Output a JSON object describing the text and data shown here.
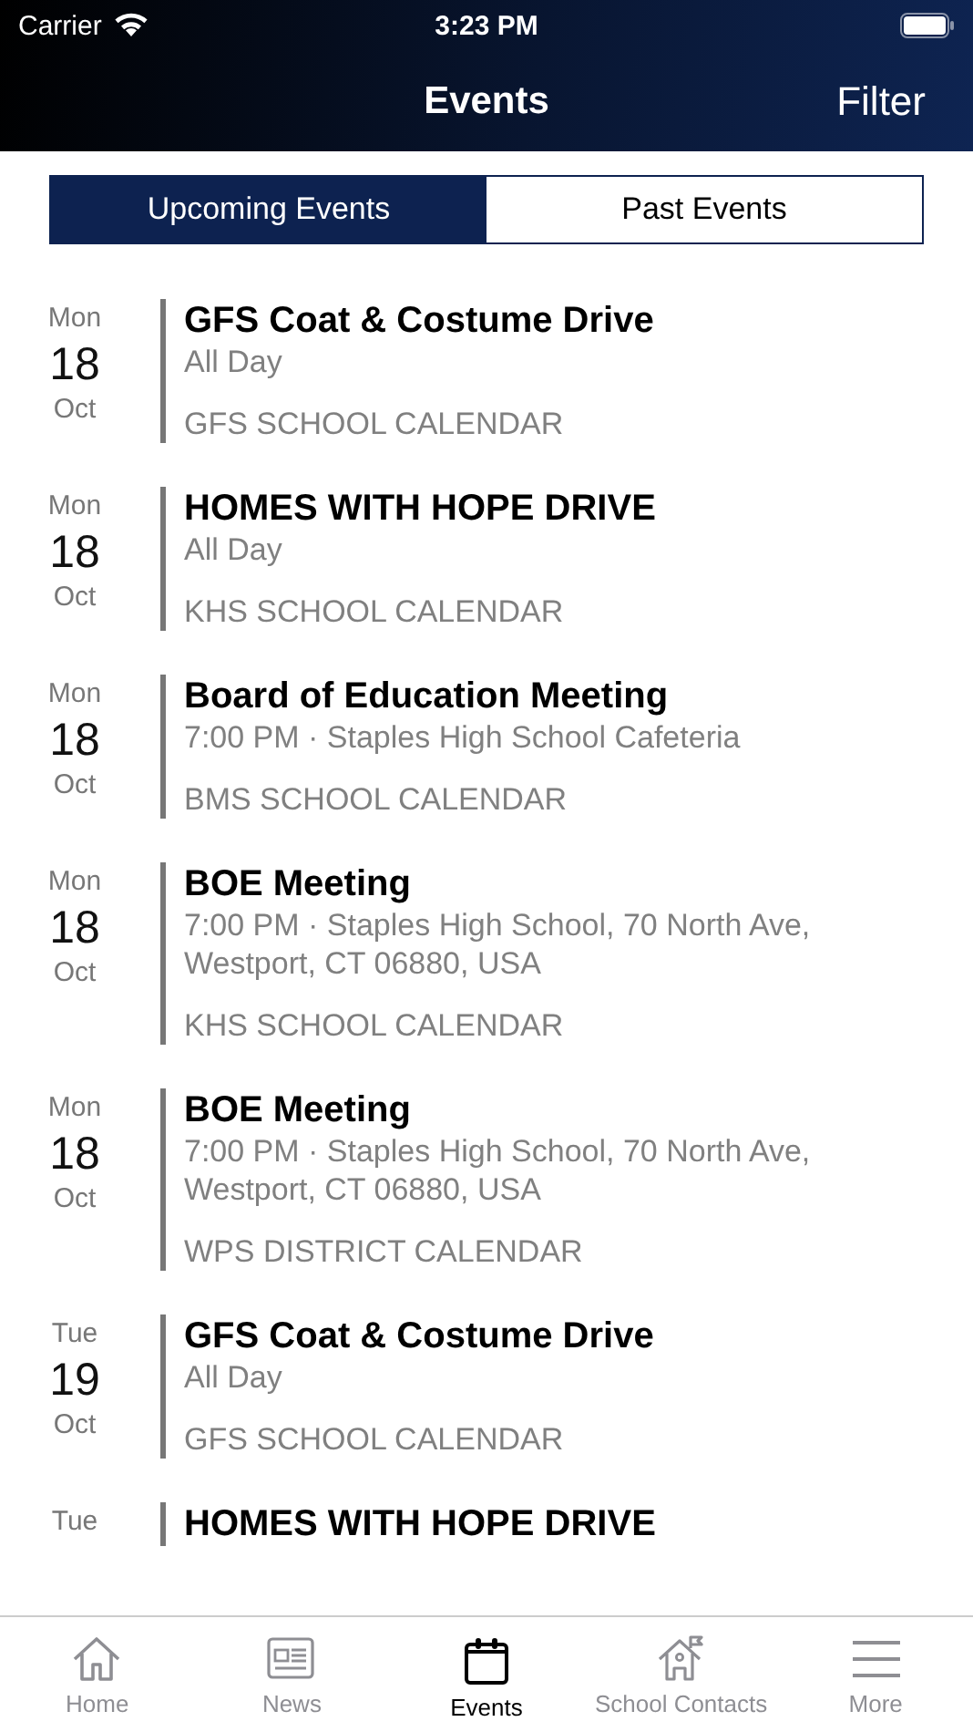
{
  "status_bar": {
    "carrier": "Carrier",
    "time": "3:23 PM"
  },
  "nav": {
    "title": "Events",
    "action": "Filter"
  },
  "segments": [
    {
      "label": "Upcoming Events",
      "selected": true
    },
    {
      "label": "Past Events",
      "selected": false
    }
  ],
  "events": [
    {
      "weekday": "Mon",
      "day": "18",
      "month": "Oct",
      "title": "GFS Coat & Costume Drive",
      "detail": "All Day",
      "calendar": "GFS SCHOOL CALENDAR"
    },
    {
      "weekday": "Mon",
      "day": "18",
      "month": "Oct",
      "title": "HOMES WITH HOPE DRIVE",
      "detail": "All Day",
      "calendar": "KHS SCHOOL CALENDAR"
    },
    {
      "weekday": "Mon",
      "day": "18",
      "month": "Oct",
      "title": "Board of Education Meeting",
      "detail": "7:00 PM · Staples High School Cafeteria",
      "calendar": "BMS SCHOOL CALENDAR"
    },
    {
      "weekday": "Mon",
      "day": "18",
      "month": "Oct",
      "title": "BOE Meeting",
      "detail": "7:00 PM · Staples High School, 70 North Ave, Westport, CT 06880, USA",
      "calendar": "KHS SCHOOL CALENDAR"
    },
    {
      "weekday": "Mon",
      "day": "18",
      "month": "Oct",
      "title": "BOE Meeting",
      "detail": "7:00 PM · Staples High School, 70 North Ave, Westport, CT 06880, USA",
      "calendar": "WPS DISTRICT CALENDAR"
    },
    {
      "weekday": "Tue",
      "day": "19",
      "month": "Oct",
      "title": "GFS Coat & Costume Drive",
      "detail": "All Day",
      "calendar": "GFS SCHOOL CALENDAR"
    },
    {
      "weekday": "Tue",
      "title": "HOMES WITH HOPE DRIVE"
    }
  ],
  "tab_bar": [
    {
      "kind": "home",
      "label": "Home",
      "selected": false
    },
    {
      "kind": "news",
      "label": "News",
      "selected": false
    },
    {
      "kind": "events",
      "label": "Events",
      "selected": true
    },
    {
      "kind": "contacts",
      "label": "School Contacts",
      "selected": false
    },
    {
      "kind": "more",
      "label": "More",
      "selected": false
    }
  ]
}
